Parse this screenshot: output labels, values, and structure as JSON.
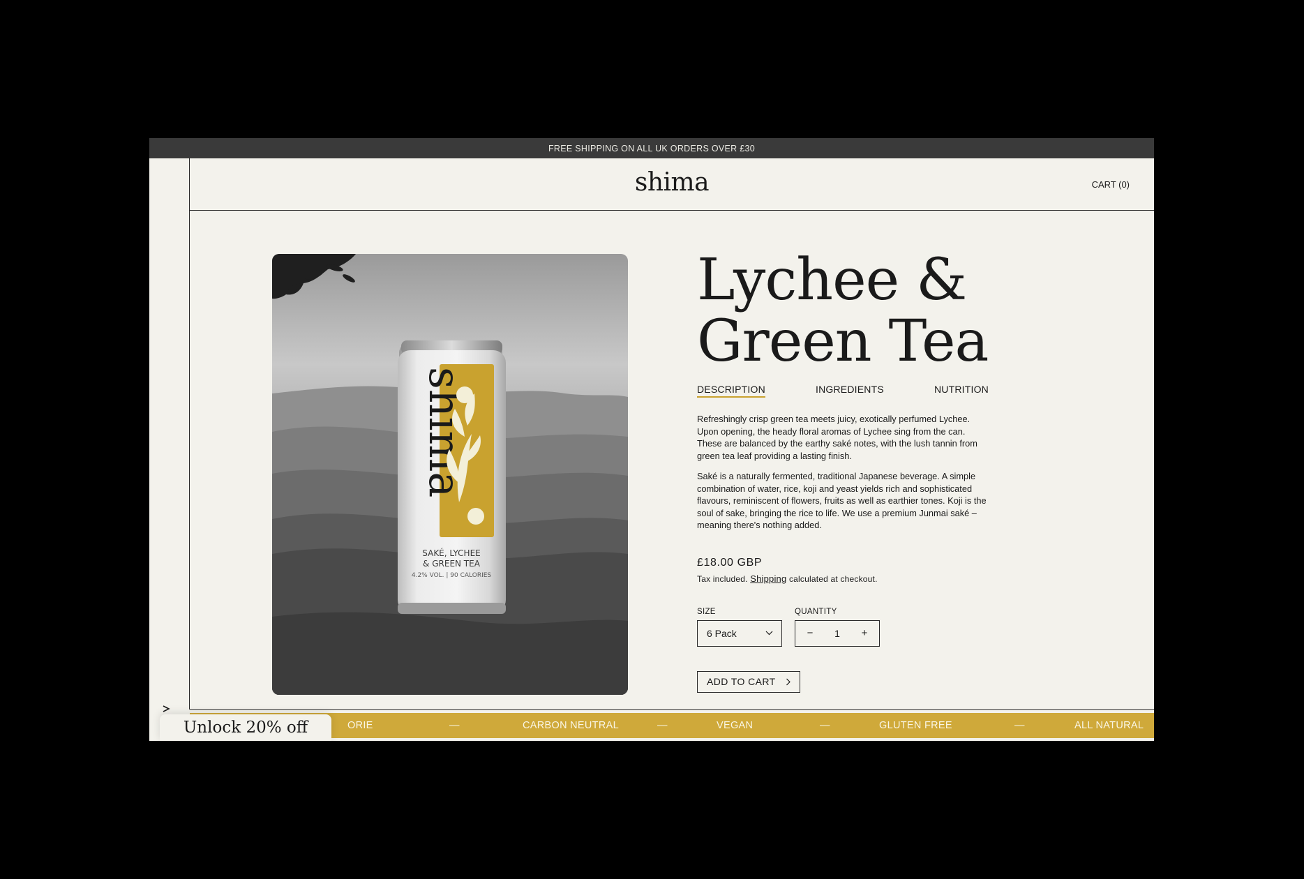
{
  "announcement": "FREE SHIPPING ON ALL UK ORDERS OVER £30",
  "header": {
    "logo": "shima",
    "cart": "CART (0)"
  },
  "product": {
    "title_line1": "Lychee &",
    "title_line2": "Green Tea",
    "tabs": [
      {
        "label": "DESCRIPTION",
        "active": true
      },
      {
        "label": "INGREDIENTS",
        "active": false
      },
      {
        "label": "NUTRITION",
        "active": false
      }
    ],
    "description_1": "Refreshingly crisp green tea meets juicy, exotically perfumed Lychee. Upon opening, the heady floral aromas of Lychee sing from the can. These are balanced by the earthy saké notes, with the lush tannin from green tea leaf providing a lasting finish.",
    "description_2": "Saké is a naturally fermented, traditional Japanese beverage. A simple combination of water, rice, koji and yeast yields rich and sophisticated flavours, reminiscent of flowers, fruits as well as earthier tones. Koji is the soul of sake, bringing the rice to life. We use a premium Junmai saké – meaning there's nothing added.",
    "price": "£18.00 GBP",
    "tax_prefix": "Tax included.",
    "tax_link": "Shipping",
    "tax_suffix": "calculated at checkout.",
    "size_label": "SIZE",
    "size_value": "6 Pack",
    "quantity_label": "QUANTITY",
    "quantity_value": "1",
    "add_to_cart": "ADD TO CART"
  },
  "can": {
    "brand": "shima",
    "line1": "SAKÉ, LYCHEE",
    "line2": "& GREEN TEA",
    "line3": "4.2% VOL. | 90 CALORIES"
  },
  "marquee": [
    "ORIE",
    "CARBON NEUTRAL",
    "VEGAN",
    "GLUTEN FREE",
    "ALL NATURAL"
  ],
  "marquee_separator": "—",
  "promo": "Unlock 20% off",
  "colors": {
    "accent": "#cfa93a",
    "background": "#f3f2ec",
    "text": "#1a1a1a",
    "announcement_bg": "#3a3a3a"
  }
}
